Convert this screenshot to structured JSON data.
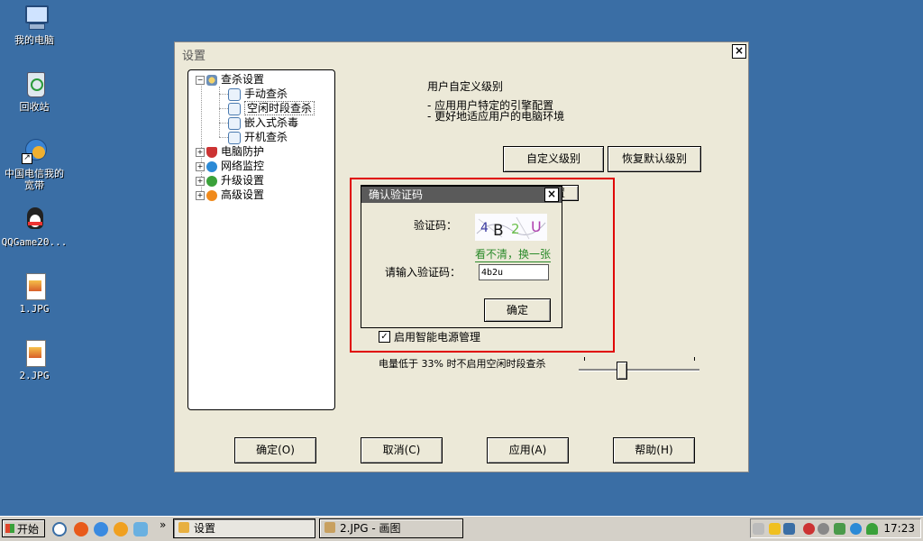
{
  "desktop": {
    "icons": [
      {
        "label": "我的电脑",
        "icon": "my-computer-icon"
      },
      {
        "label": "回收站",
        "icon": "recycle-bin-icon"
      },
      {
        "label": "中国电信我的宽带",
        "icon": "broadband-icon"
      },
      {
        "label": "QQGame20...",
        "icon": "qqgame-icon"
      },
      {
        "label": "1.JPG",
        "icon": "jpg-file-icon"
      },
      {
        "label": "2.JPG",
        "icon": "jpg-file-icon"
      }
    ]
  },
  "window": {
    "title": "设置",
    "tree": {
      "root": "查杀设置",
      "children": [
        "手动查杀",
        "空闲时段查杀",
        "嵌入式杀毒",
        "开机查杀"
      ],
      "selected": "空闲时段查杀",
      "others": [
        "电脑防护",
        "网络监控",
        "升级设置",
        "高级设置"
      ]
    },
    "level_title": "用户自定义级别",
    "level_desc": [
      "- 应用用户特定的引擎配置",
      "- 更好地适应用户的电脑环境"
    ],
    "custom_level_button": "自定义级别",
    "restore_default_button": "恢复默认级别",
    "partial_button_text": "置",
    "power_checkbox": {
      "label": "启用智能电源管理",
      "checked": true
    },
    "battery_label": "电量低于 33% 时不启用空闲时段查杀",
    "slider": {
      "percent": 33
    },
    "buttons": {
      "ok": "确定(O)",
      "cancel": "取消(C)",
      "apply": "应用(A)",
      "help": "帮助(H)"
    }
  },
  "dialog": {
    "title": "确认验证码",
    "captcha_label": "验证码：",
    "captcha_image_text": "4B2U",
    "refresh_link": "看不清，换一张",
    "input_label": "请输入验证码：",
    "input_value": "4b2u",
    "ok_button": "确定"
  },
  "taskbar": {
    "start": "开始",
    "tasks": [
      {
        "label": "设置",
        "active": true
      },
      {
        "label": "2.JPG - 画图",
        "active": false
      }
    ],
    "chevron": "»",
    "clock": "17:23"
  }
}
